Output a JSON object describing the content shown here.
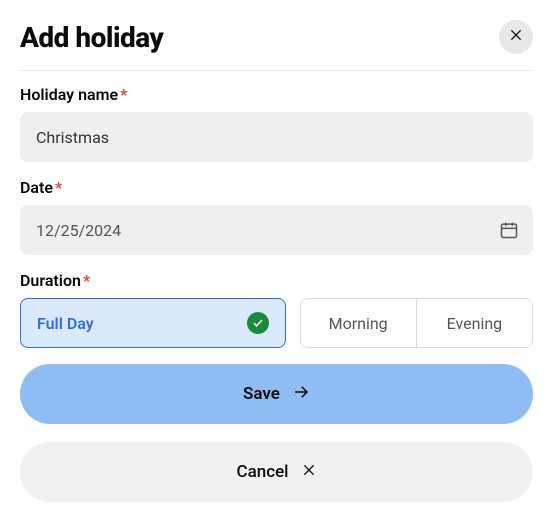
{
  "dialog": {
    "title": "Add holiday"
  },
  "fields": {
    "holiday_name": {
      "label": "Holiday name",
      "value": "Christmas"
    },
    "date": {
      "label": "Date",
      "value": "12/25/2024"
    },
    "duration": {
      "label": "Duration",
      "options": {
        "full_day": "Full Day",
        "morning": "Morning",
        "evening": "Evening"
      },
      "selected": "full_day"
    }
  },
  "buttons": {
    "save": "Save",
    "cancel": "Cancel"
  },
  "required_marker": "*"
}
